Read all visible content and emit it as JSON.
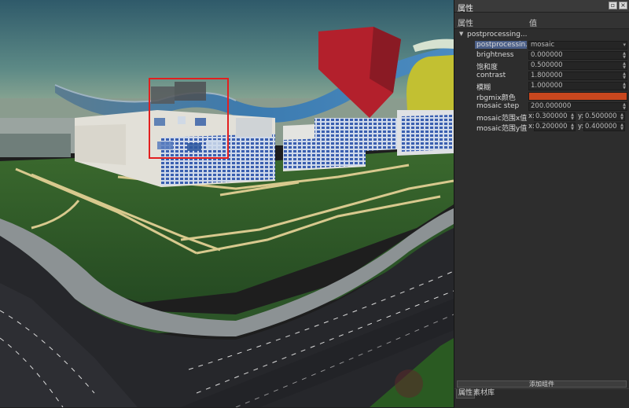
{
  "panel": {
    "title": "属性",
    "window_buttons": [
      "restore-icon",
      "close-icon"
    ],
    "columns": {
      "property": "属性",
      "value": "值"
    },
    "group": {
      "label": "postprocessing...",
      "expanded": true
    },
    "rows": [
      {
        "label": "postprocessin...",
        "value": "mosaic",
        "type": "select"
      },
      {
        "label": "brightness",
        "value": "0.000000",
        "type": "spin"
      },
      {
        "label": "饱和度",
        "value": "0.500000",
        "type": "spin"
      },
      {
        "label": "contrast",
        "value": "1.800000",
        "type": "spin"
      },
      {
        "label": "模糊",
        "value": "1.000000",
        "type": "spin"
      },
      {
        "label": "rbgmix颜色",
        "color": "#c8471e",
        "type": "color"
      },
      {
        "label": "mosaic step",
        "value": "200.000000",
        "type": "spin"
      },
      {
        "label": "mosaic范围x值",
        "x_tag": "x:",
        "x": "0.300000",
        "y_tag": "y:",
        "y": "0.500000",
        "type": "xy"
      },
      {
        "label": "mosaic范围y值",
        "x_tag": "x:",
        "x": "0.200000",
        "y_tag": "y:",
        "y": "0.400000",
        "type": "xy"
      }
    ],
    "add_button": "添加组件",
    "tabs": [
      "属性",
      "素材库"
    ]
  },
  "viewport": {
    "highlight_color": "#e21f1f",
    "sky_top": "#335f6c",
    "sky_bottom": "#98b09a",
    "grass": "#2f5a2a",
    "road": "#2a2a2e",
    "roof": "#3a6f95",
    "red_block": "#b81e2c"
  }
}
